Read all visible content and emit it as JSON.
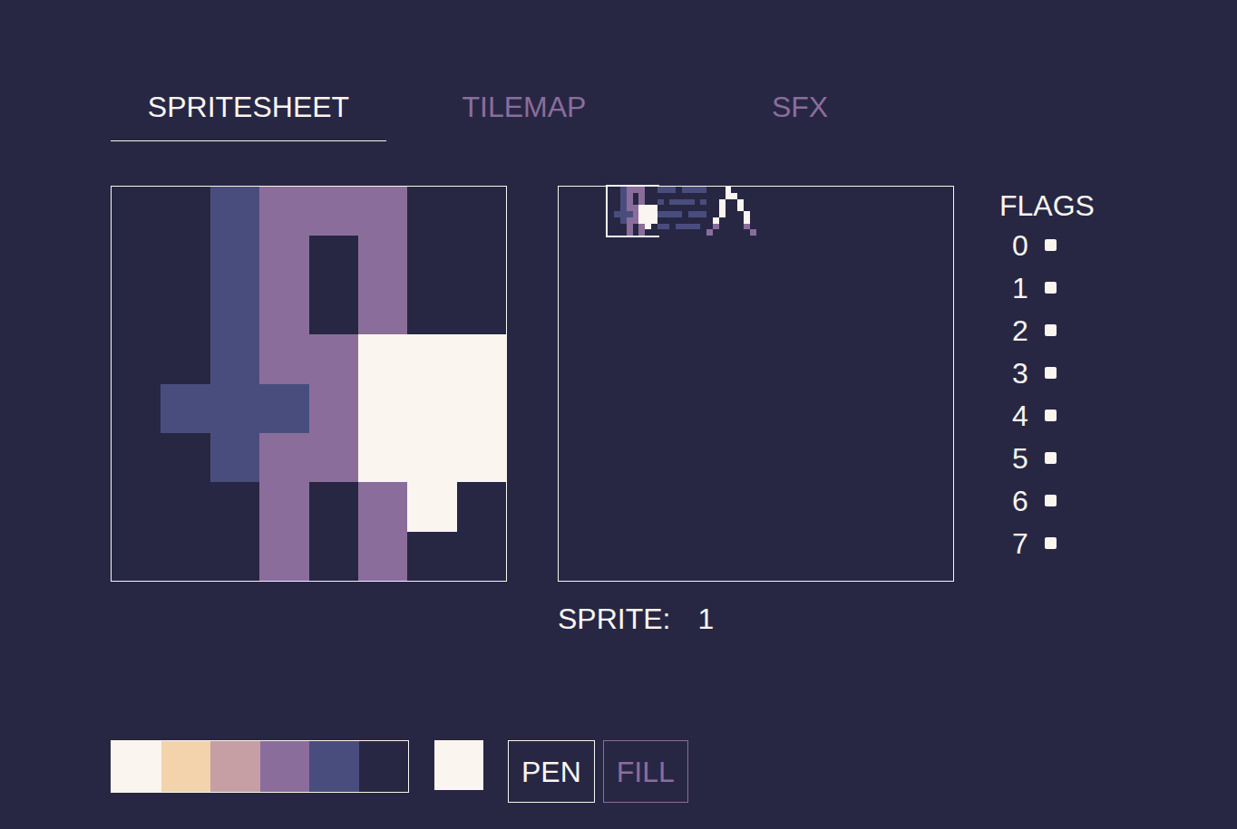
{
  "tabs": [
    {
      "label": "SPRITESHEET",
      "selected": true
    },
    {
      "label": "TILEMAP",
      "selected": false
    },
    {
      "label": "SFX",
      "selected": false
    }
  ],
  "palette": [
    {
      "color": "#fbf5ef"
    },
    {
      "color": "#f2d3ab"
    },
    {
      "color": "#c69fa5"
    },
    {
      "color": "#8b6d9c"
    },
    {
      "color": "#494d7e"
    },
    {
      "color": "#272744"
    }
  ],
  "current_color": "#fbf5ef",
  "sprites": [
    {
      "selected": false,
      "pixels": [
        "55555555",
        "55555555",
        "55555555",
        "55555555",
        "55555555",
        "55555555",
        "55555555",
        "55555555"
      ]
    },
    {
      "selected": true,
      "pixels": [
        "55433355",
        "55435355",
        "55435355",
        "55433000",
        "54443000",
        "55433000",
        "55535305",
        "55535355"
      ]
    },
    {
      "selected": false,
      "pixels": [
        "44454444",
        "55555555",
        "45444454",
        "55555555",
        "44445444",
        "55555555",
        "44544445",
        "55555555"
      ]
    },
    {
      "selected": false,
      "pixels": [
        "55505555",
        "55500555",
        "55055055",
        "55055055",
        "55055505",
        "50555505",
        "53555535",
        "35555553"
      ]
    }
  ],
  "sprite_label": "SPRITE:",
  "sprite_number": "1",
  "flags": {
    "title": "FLAGS",
    "items": [
      {
        "label": "0",
        "checked": false
      },
      {
        "label": "1",
        "checked": false
      },
      {
        "label": "2",
        "checked": false
      },
      {
        "label": "3",
        "checked": false
      },
      {
        "label": "4",
        "checked": false
      },
      {
        "label": "5",
        "checked": false
      },
      {
        "label": "6",
        "checked": false
      },
      {
        "label": "7",
        "checked": false
      }
    ]
  },
  "tools": [
    {
      "label": "PEN",
      "selected": true
    },
    {
      "label": "FILL",
      "selected": false
    }
  ]
}
